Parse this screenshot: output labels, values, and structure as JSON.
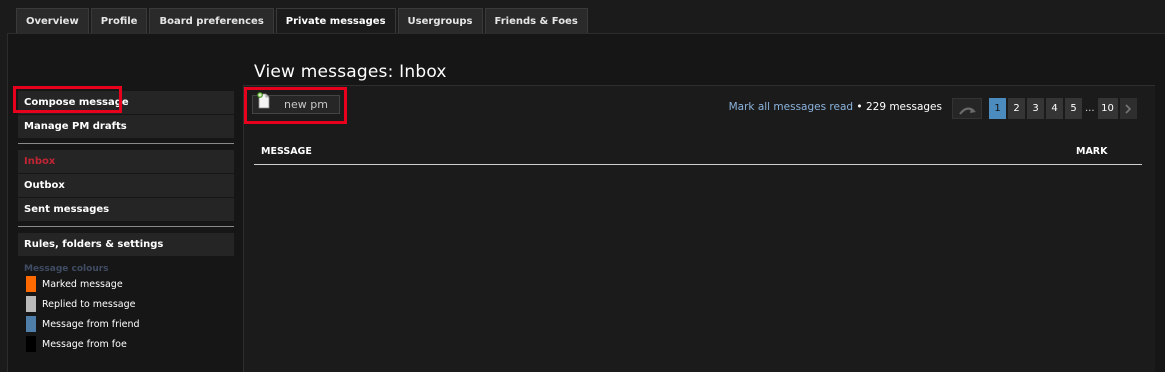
{
  "tabs": [
    "Overview",
    "Profile",
    "Board preferences",
    "Private messages",
    "Usergroups",
    "Friends & Foes"
  ],
  "active_tab": "Private messages",
  "page_title": "View messages: Inbox",
  "leftmenu": {
    "compose": "Compose message",
    "drafts": "Manage PM drafts",
    "inbox": "Inbox",
    "outbox": "Outbox",
    "sent": "Sent messages",
    "rules": "Rules, folders & settings"
  },
  "colours": {
    "title": "Message colours",
    "items": [
      {
        "label": "Marked message",
        "color": "#ff6a00"
      },
      {
        "label": "Replied to message",
        "color": "#b9b9b9"
      },
      {
        "label": "Message from friend",
        "color": "#4f7ea8"
      },
      {
        "label": "Message from foe",
        "color": "#000000"
      }
    ]
  },
  "newpm_label": "new pm",
  "status": {
    "mark_all": "Mark all messages read",
    "bullet": " • ",
    "count": "229 messages"
  },
  "pagination": {
    "pages": [
      "1",
      "2",
      "3",
      "4",
      "5"
    ],
    "ellipsis": "...",
    "last": "10",
    "current": "1"
  },
  "table": {
    "col_message": "MESSAGE",
    "col_mark": "MARK"
  },
  "icons": {
    "newpm": "new-document-icon",
    "reload": "curved-arrow-icon",
    "next": "chevron-right-icon"
  },
  "highlight_color": "#e8001c"
}
